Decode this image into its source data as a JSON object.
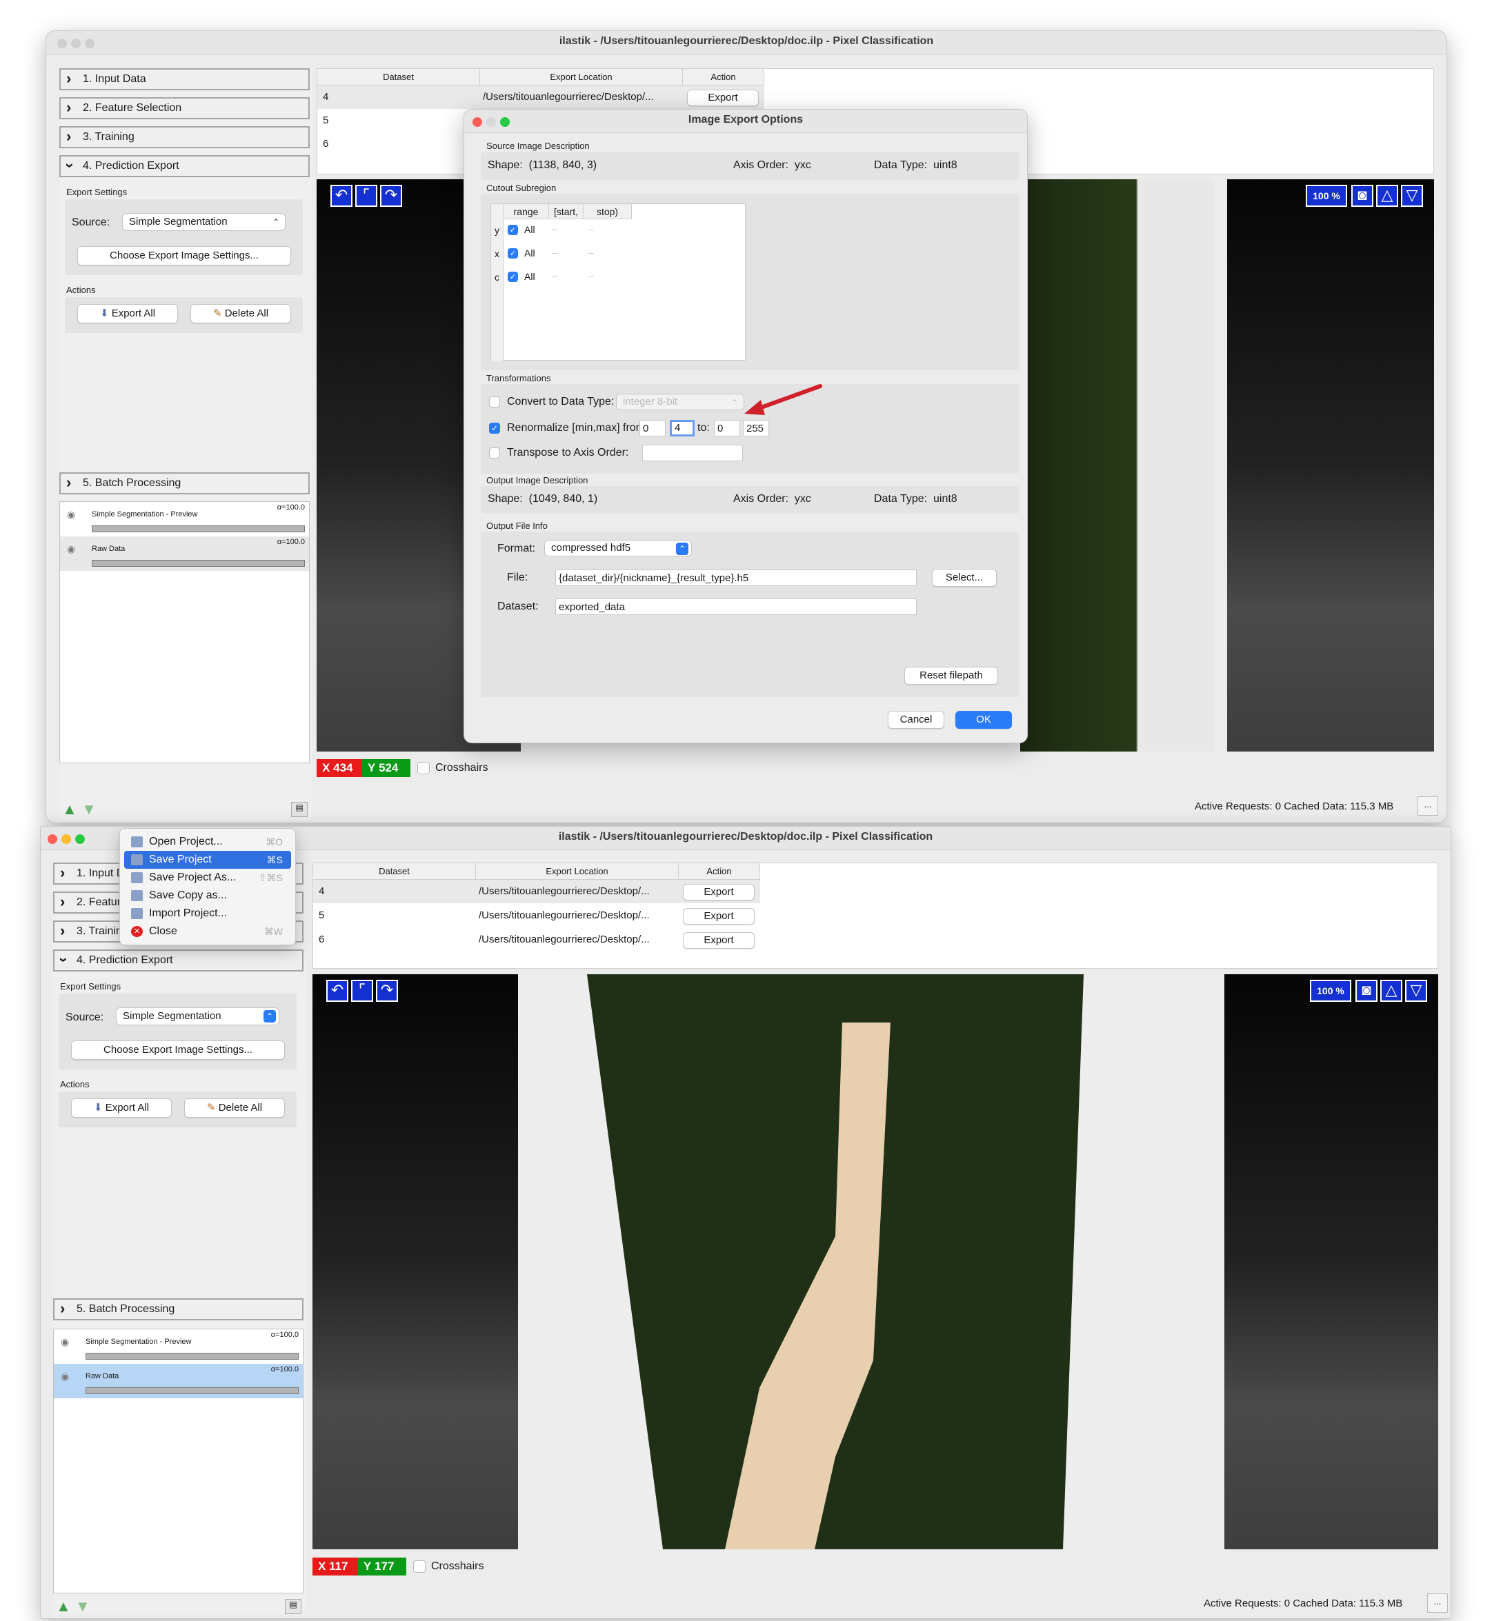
{
  "window_title": "ilastik - /Users/titouanlegourrierec/Desktop/doc.ilp - Pixel Classification",
  "applets": {
    "input": "1. Input Data",
    "feature": "2. Feature Selection",
    "training": "3. Training",
    "export": "4. Prediction Export",
    "batch": "5. Batch Processing",
    "input_short": "1. Input D",
    "feature_short": "2. Featur",
    "training_short": "3. Trainir"
  },
  "export_panel": {
    "settings_heading": "Export Settings",
    "source_label": "Source:",
    "source_value": "Simple Segmentation",
    "choose_settings": "Choose Export Image Settings...",
    "actions_heading": "Actions",
    "export_all": "Export All",
    "delete_all": "Delete All"
  },
  "layers": [
    {
      "name": "Simple Segmentation - Preview",
      "alpha": "α=100.0"
    },
    {
      "name": "Raw Data",
      "alpha": "α=100.0"
    }
  ],
  "table": {
    "headers": [
      "Dataset",
      "Export Location",
      "Action"
    ],
    "rows": [
      {
        "dataset": "4",
        "location": "/Users/titouanlegourrierec/Desktop/...",
        "action": "Export"
      },
      {
        "dataset": "5",
        "location": "/Users/titouanlegourrierec/Desktop/...",
        "action": "Export"
      },
      {
        "dataset": "6",
        "location": "/Users/titouanlegourrierec/Desktop/...",
        "action": "Export"
      }
    ]
  },
  "viewer": {
    "zoom": "100 %",
    "crosshairs": "Crosshairs",
    "top_x_label": "X",
    "top_x": "434",
    "top_y_label": "Y",
    "top_y": "524",
    "bottom_x": "117",
    "bottom_y": "177"
  },
  "status": {
    "text": "Active Requests: 0  Cached Data: 115.3 MB",
    "more": "..."
  },
  "dialog": {
    "title": "Image Export Options",
    "source_heading": "Source Image Description",
    "shape_label": "Shape:",
    "source_shape": "(1138, 840, 3)",
    "axis_label": "Axis Order:",
    "axis_value": "yxc",
    "dtype_label": "Data Type:",
    "dtype_value": "uint8",
    "cutout_heading": "Cutout Subregion",
    "cutout_cols": [
      "range",
      "[start,",
      "stop)"
    ],
    "cutout_rows": [
      {
        "axis": "y",
        "range": "All",
        "start": "--",
        "stop": "--"
      },
      {
        "axis": "x",
        "range": "All",
        "start": "--",
        "stop": "--"
      },
      {
        "axis": "c",
        "range": "All",
        "start": "--",
        "stop": "--"
      }
    ],
    "transform_heading": "Transformations",
    "convert_label": "Convert to Data Type:",
    "convert_value": "integer 8-bit",
    "renorm_label": "Renormalize [min,max] from:",
    "renorm_from_min": "0",
    "renorm_from_max": "4",
    "renorm_to_label": "to:",
    "renorm_to_min": "0",
    "renorm_to_max": "255",
    "transpose_label": "Transpose to Axis Order:",
    "output_heading": "Output Image Description",
    "output_shape": "(1049, 840, 1)",
    "file_heading": "Output File Info",
    "format_label": "Format:",
    "format_value": "compressed hdf5",
    "file_label": "File:",
    "file_value": "{dataset_dir}/{nickname}_{result_type}.h5",
    "select_button": "Select...",
    "dataset_label": "Dataset:",
    "dataset_value": "exported_data",
    "reset_button": "Reset filepath",
    "cancel_button": "Cancel",
    "ok_button": "OK"
  },
  "file_menu": [
    {
      "label": "Open Project...",
      "shortcut": "⌘O"
    },
    {
      "label": "Save Project",
      "shortcut": "⌘S"
    },
    {
      "label": "Save Project As...",
      "shortcut": "⇧⌘S"
    },
    {
      "label": "Save Copy as...",
      "shortcut": ""
    },
    {
      "label": "Import Project...",
      "shortcut": ""
    },
    {
      "label": "Close",
      "shortcut": "⌘W"
    }
  ],
  "colors": {
    "accent": "#2a7cf6",
    "viewer_button": "#1530d0",
    "coord_x": "#e81a1a",
    "coord_y": "#0a9a18",
    "arrow": "#d0202a"
  }
}
